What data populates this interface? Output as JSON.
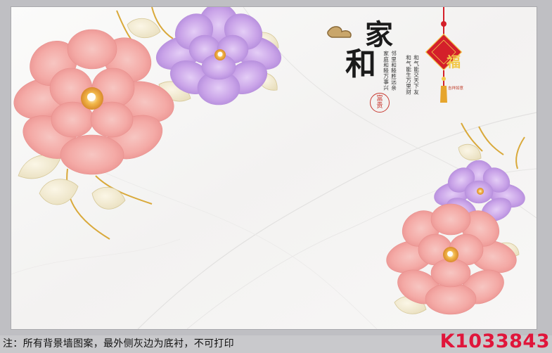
{
  "artwork": {
    "title_char_1": "家",
    "title_char_2": "和",
    "seal_top": "富",
    "seal_bottom": "贵",
    "poem_columns": [
      "和气能交天下友",
      "和气能生万里财",
      "邻里和睦胜远亲",
      "家庭和睦万事兴"
    ],
    "pendant_char": "福",
    "pendant_caption": "吉祥如意",
    "colors": {
      "pink_flower": "#f4a9a8",
      "purple_flower": "#c9a3e8",
      "gold_stem": "#d9a93a",
      "knot_red": "#d4202a"
    }
  },
  "footer": {
    "note": "注：所有背景墙图案，最外侧灰边为底衬，不可打印",
    "product_code": "K1033843"
  }
}
